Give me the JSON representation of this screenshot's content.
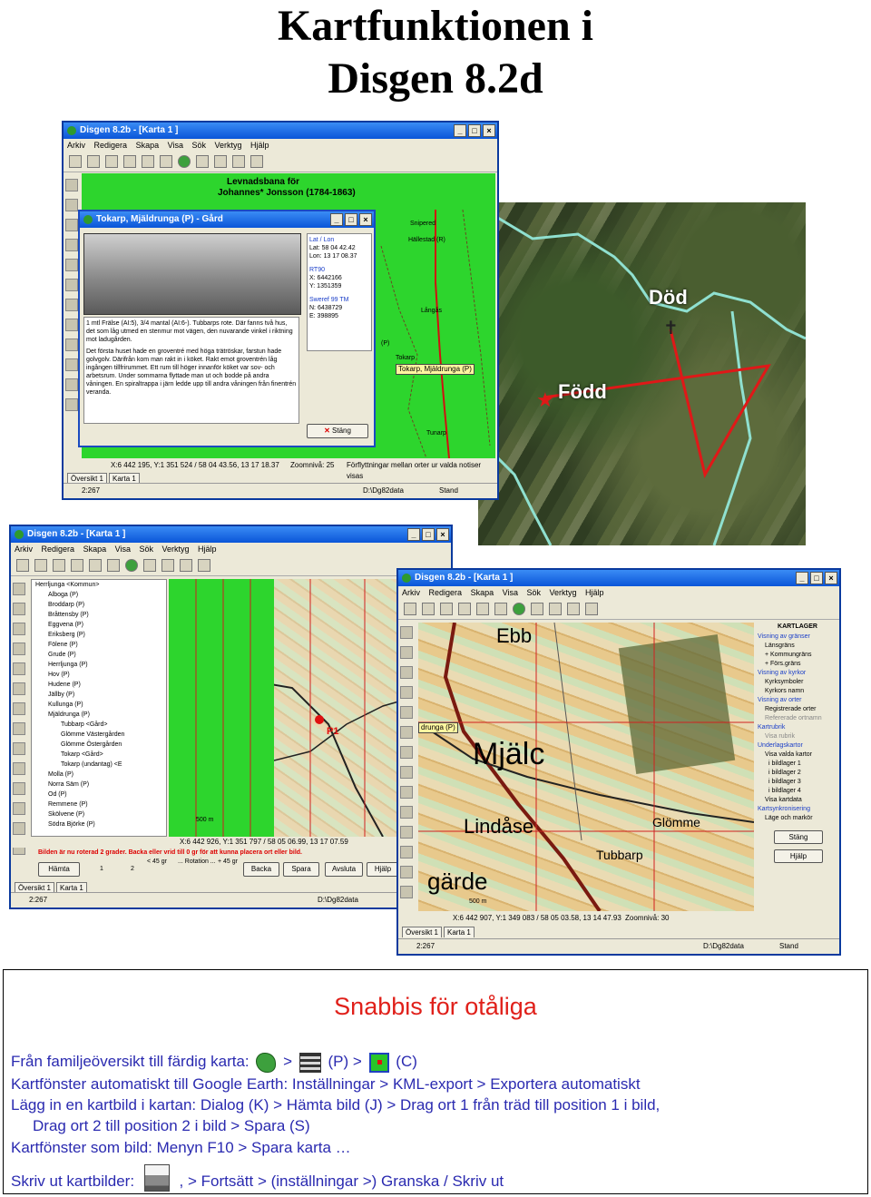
{
  "title_line1": "Kartfunktionen i",
  "title_line2": "Disgen 8.2d",
  "win1": {
    "title": "Disgen 8.2b - [Karta 1 ]",
    "menu": [
      "Arkiv",
      "Redigera",
      "Skapa",
      "Visa",
      "Sök",
      "Verktyg",
      "Hjälp"
    ],
    "map_title": "Levnadsbana för",
    "map_person": "Johannes* Jonsson (1784-1863)",
    "dialog_title": "Tokarp, Mjäldrunga (P) - Gård",
    "coord_sections": [
      {
        "head": "Lat / Lon",
        "lines": [
          "Lat: 58 04 42.42",
          "Lon: 13 17 08.37"
        ]
      },
      {
        "head": "RT90",
        "lines": [
          "X: 6442166",
          "Y: 1351359"
        ]
      },
      {
        "head": "Sweref 99 TM",
        "lines": [
          "N: 6438729",
          "E: 398895"
        ]
      }
    ],
    "dialog_text_1": "1 mtl Frälse (AI:5), 3/4 mantal (AI:6-). Tubbarps rote. Där fanns två hus, det som låg utmed en stenmur mot vägen, den nuvarande vinkel i riktning mot ladugården.",
    "dialog_text_2": "Det första huset hade en groventré med höga trätröskar, farstun hade golvgolv. Därifrån kom man rakt in i köket. Rakt emot groventrén låg ingången tillfrirummet. Ett rum till höger innanför köket var sov- och arbetsrum. Under sommarna flyttade man ut och bodde på andra våningen. En spiraltrappa i järn ledde upp till andra våningen från finentrén veranda.",
    "close_button": "Stäng",
    "places": [
      "Snipered",
      "Hällestad (R)",
      "Långås",
      "(P)",
      "Tokarp",
      "Tunarp"
    ],
    "yellow_label": "Tokarp, Mjäldrunga (P)",
    "coords_bar": "X:6 442 195, Y:1 351 524 / 58 04 43.56, 13 17 18.37",
    "zoom": "Zoomnivå: 25",
    "hint": "Förflyttningar mellan orter ur valda notiser visas",
    "tabs": [
      "Översikt 1",
      "Karta 1"
    ],
    "status_left": "2:267",
    "status_mid": "D:\\Dg82data",
    "status_right": "Stand"
  },
  "satellite": {
    "death_label": "Död",
    "birth_label": "Född"
  },
  "win2": {
    "title": "Disgen 8.2b - [Karta 1 ]",
    "menu": [
      "Arkiv",
      "Redigera",
      "Skapa",
      "Visa",
      "Sök",
      "Verktyg",
      "Hjälp"
    ],
    "tree": [
      "Herrljunga <Kommun>",
      "Alboga (P)",
      "Broddarp (P)",
      "Bråttensby (P)",
      "Eggvena (P)",
      "Eriksberg (P)",
      "Fölene (P)",
      "Grude (P)",
      "Herrljunga (P)",
      "Hov (P)",
      "Hudene (P)",
      "Jällby (P)",
      "Kullunga (P)",
      "Mjäldrunga (P)",
      "Tubbarp <Gård>",
      "Glömme Västergården",
      "Glömme Östergården",
      "Tokarp <Gård>",
      "Tokarp (undantag) <E",
      "Molla (P)",
      "Norra Säm (P)",
      "Od (P)",
      "Remmene (P)",
      "Skölvene (P)",
      "Södra Björke (P)"
    ],
    "marker_label": "P1",
    "scale": "500 m",
    "coords_bar": "X:6 442 926, Y:1 351 797 / 58 05 06.99, 13 17 07.59",
    "warning": "Bilden är nu roterad 2 grader. Backa eller vrid till 0 gr för att kunna placera ort eller bild.",
    "rot_left": "< 45 gr",
    "rot_mid": "... Rotation ...",
    "rot_right": "+ 45 gr",
    "buttons": [
      "Hämta",
      "Backa",
      "Spara",
      "Avsluta",
      "Hjälp"
    ],
    "button_nums": [
      "1",
      "2"
    ],
    "tabs": [
      "Översikt 1",
      "Karta 1"
    ],
    "status_left": "2:267",
    "status_mid": "D:\\Dg82data"
  },
  "win3": {
    "title": "Disgen 8.2b - [Karta 1 ]",
    "menu": [
      "Arkiv",
      "Redigera",
      "Skapa",
      "Visa",
      "Sök",
      "Verktyg",
      "Hjälp"
    ],
    "map_words": [
      "Ebb",
      "Mjälc",
      "Lindåse",
      "gärde",
      "Glömme",
      "Tubbarp"
    ],
    "map_label": "drunga (P)",
    "kartlager": {
      "title": "KARTLAGER",
      "items": [
        {
          "text": "Visning av gränser",
          "head": true
        },
        {
          "text": "Länsgräns"
        },
        {
          "text": "+ Kommungräns"
        },
        {
          "text": "+ Förs.gräns"
        },
        {
          "text": "Visning av kyrkor",
          "head": true
        },
        {
          "text": "Kyrksymboler"
        },
        {
          "text": "Kyrkors namn"
        },
        {
          "text": "Visning av orter",
          "head": true
        },
        {
          "text": "Registrerade orter"
        },
        {
          "text": "Refererade ortnamn"
        },
        {
          "text": "Kartrubrik",
          "head": true
        },
        {
          "text": "Visa rubrik"
        },
        {
          "text": "Underlagskartor",
          "head": true
        },
        {
          "text": "Visa valda kartor"
        },
        {
          "text": "i bildlager 1"
        },
        {
          "text": "i bildlager 2"
        },
        {
          "text": "i bildlager 3"
        },
        {
          "text": "i bildlager 4"
        },
        {
          "text": "Visa kartdata"
        },
        {
          "text": "Kartsynkronisering",
          "head": true
        },
        {
          "text": "Läge och markör"
        }
      ],
      "btn_close": "Stäng",
      "btn_help": "Hjälp"
    },
    "scale": "500 m",
    "coords_bar": "X:6 442 907, Y:1 349 083 / 58 05 03.58, 13 14 47.93",
    "zoom": "Zoomnivå: 30",
    "tabs": [
      "Översikt 1",
      "Karta 1"
    ],
    "status_left": "2:267",
    "status_mid": "D:\\Dg82data",
    "status_right": "Stand"
  },
  "snabbis": {
    "heading": "Snabbis för otåliga",
    "line1": {
      "a": "Från familjeöversikt till färdig karta:",
      "b": ">",
      "c": "(P)  >",
      "d": "(C)"
    },
    "line2": "Kartfönster automatiskt till Google Earth: Inställningar > KML-export > Exportera automatiskt",
    "line3": "Lägg in en kartbild i kartan: Dialog (K) > Hämta bild (J) > Drag ort 1 från träd till position 1 i bild,",
    "line4": "Drag ort 2 till position 2 i bild > Spara (S)",
    "line5": "Kartfönster som bild: Menyn F10 > Spara karta …",
    "line6": {
      "a": "Skriv ut kartbilder:",
      "b": ", > Fortsätt  > (inställningar >)  Granska / Skriv ut"
    }
  },
  "colors": {
    "heading_red": "#e0201a",
    "text_blue": "#2a2ab0",
    "map_green": "#2dd52d"
  }
}
